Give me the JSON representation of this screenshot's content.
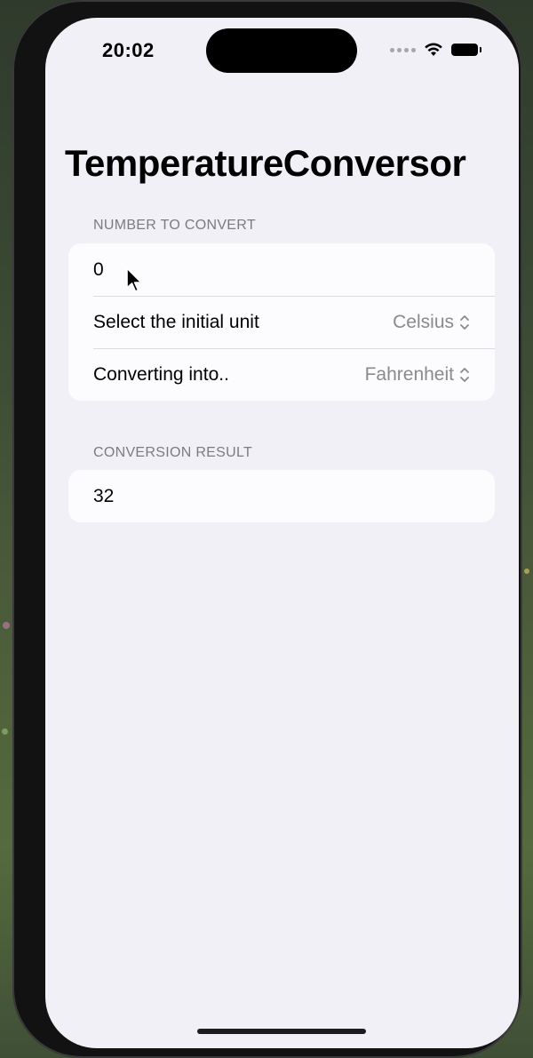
{
  "status_bar": {
    "time": "20:02"
  },
  "nav": {
    "title": "TemperatureConversor"
  },
  "input_section": {
    "header": "NUMBER TO CONVERT",
    "number_value": "0",
    "initial_unit_label": "Select the initial unit",
    "initial_unit_value": "Celsius",
    "target_unit_label": "Converting into..",
    "target_unit_value": "Fahrenheit"
  },
  "result_section": {
    "header": "CONVERSION RESULT",
    "result_value": "32"
  },
  "icons": {
    "picker_chevrons": "chevron-up-down-icon",
    "wifi": "wifi-icon",
    "battery": "battery-icon",
    "signal": "cellular-signal-icon",
    "pointer": "mouse-pointer-icon"
  },
  "colors": {
    "background": "#f1f0f6",
    "card": "#fcfcfe",
    "secondary_text": "#8a8a8e",
    "section_header": "#7b7b80"
  }
}
